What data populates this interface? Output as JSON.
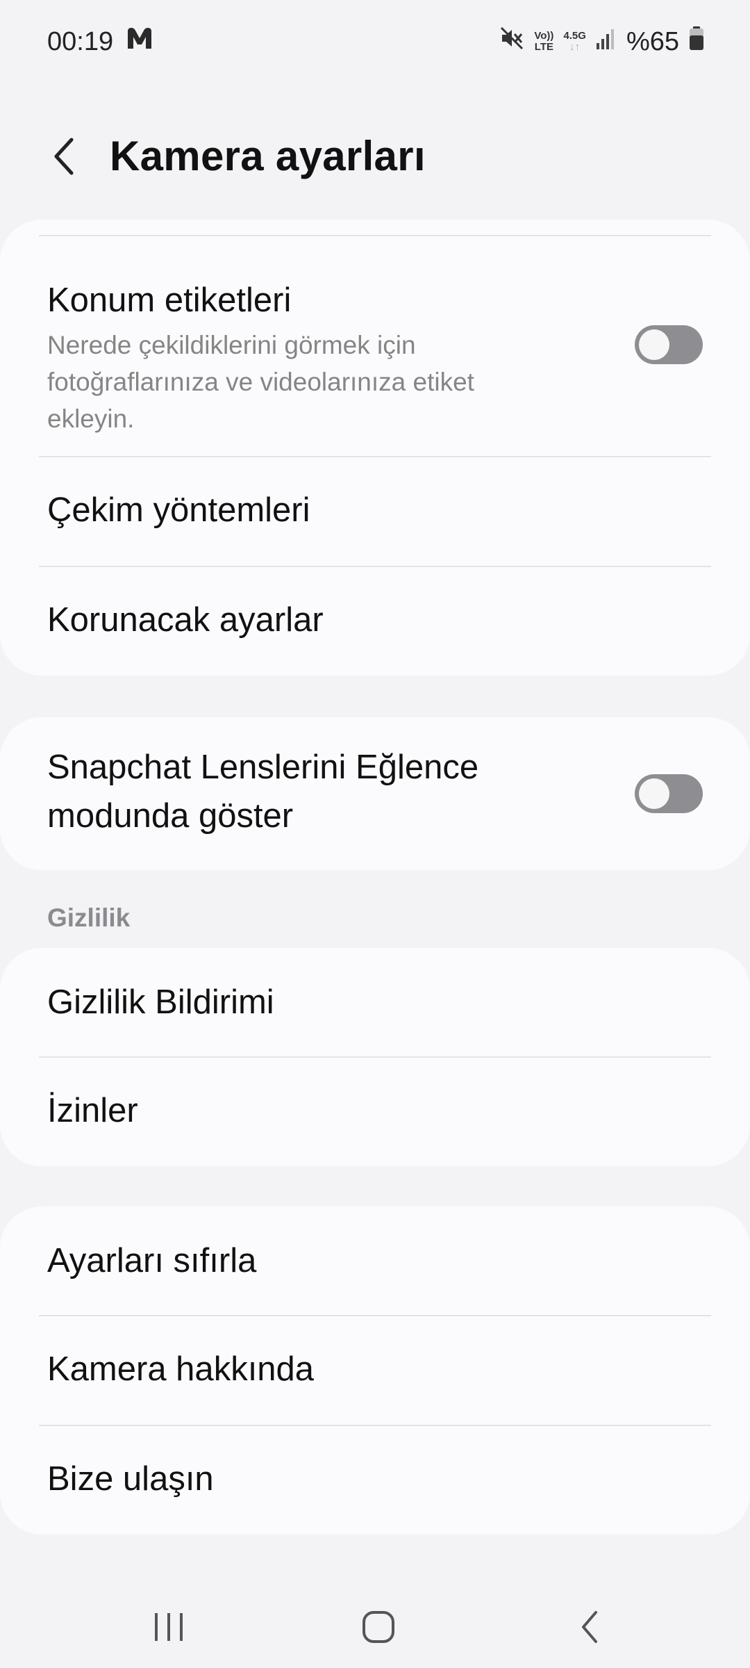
{
  "status_bar": {
    "time": "00:19",
    "app_icon": "m-app-icon",
    "mute_icon": "mute-icon",
    "volte_top": "Vo))",
    "volte_bottom": "LTE",
    "network_top": "4.5G",
    "network_bottom": "↓↑",
    "signal_icon": "signal-icon",
    "battery_text": "%65",
    "battery_icon": "battery-icon"
  },
  "header": {
    "back_icon": "back-arrow-icon",
    "title": "Kamera ayarları"
  },
  "group1": {
    "location_tags": {
      "title": "Konum etiketleri",
      "subtitle": "Nerede çekildiklerini görmek için fotoğraflarınıza ve videolarınıza etiket ekleyin.",
      "toggle_on": false
    },
    "shooting_methods": {
      "title": "Çekim yöntemleri"
    },
    "settings_to_keep": {
      "title": "Korunacak ayarlar"
    }
  },
  "group2": {
    "snapchat": {
      "title_line1": "Snapchat Lenslerini Eğlence",
      "title_line2": "modunda göster",
      "toggle_on": false
    }
  },
  "privacy_section": {
    "label": "Gizlilik",
    "items": [
      {
        "title": "Gizlilik Bildirimi"
      },
      {
        "title": "İzinler"
      }
    ]
  },
  "group4": {
    "items": [
      {
        "title": "Ayarları sıfırla"
      },
      {
        "title": "Kamera hakkında"
      },
      {
        "title": "Bize ulaşın"
      }
    ]
  },
  "nav_bar": {
    "recents_icon": "recents-icon",
    "home_icon": "home-icon",
    "back_icon": "nav-back-icon"
  },
  "colors": {
    "background": "#f3f3f5",
    "card": "#fbfbfd",
    "toggle_off": "#8d8d92",
    "secondary_text": "#858585"
  }
}
